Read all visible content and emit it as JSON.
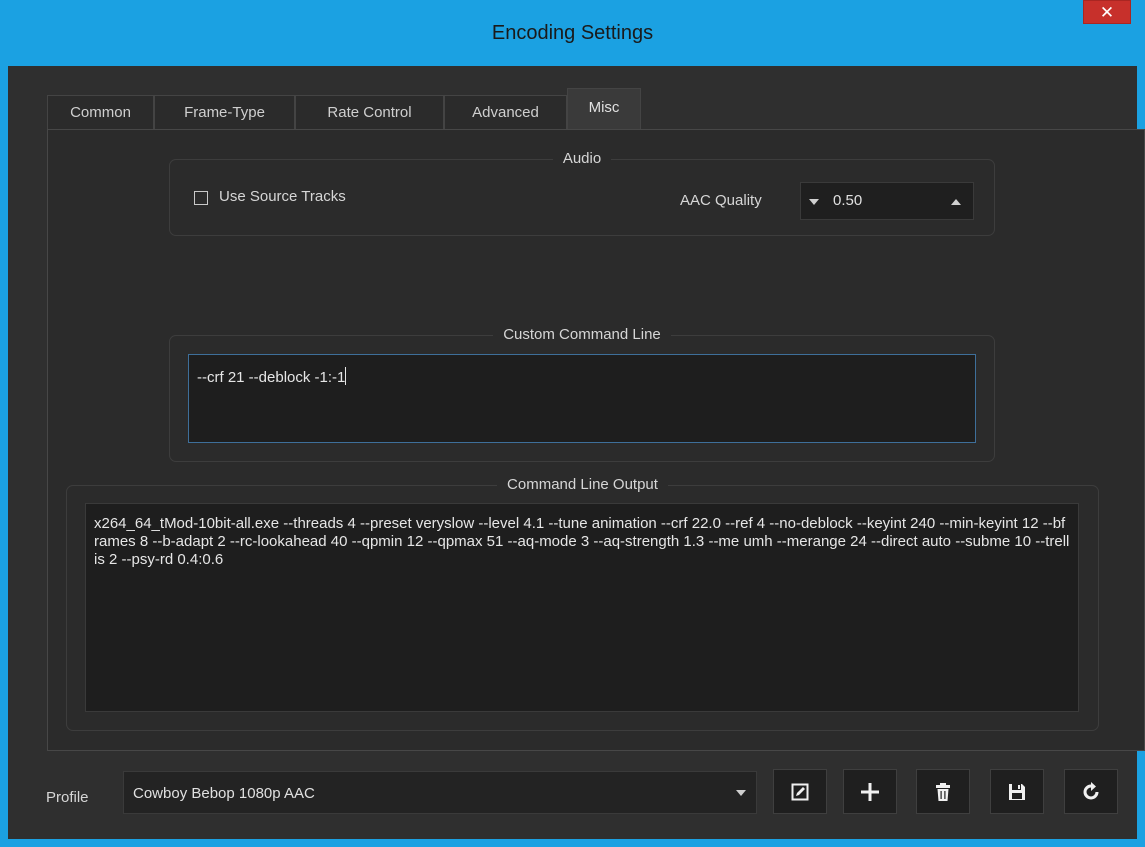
{
  "window": {
    "title": "Encoding Settings",
    "close_glyph": "✕",
    "accent_color": "#1ba1e2",
    "close_color": "#c7302b"
  },
  "tabs": [
    {
      "label": "Common",
      "active": false
    },
    {
      "label": "Frame-Type",
      "active": false
    },
    {
      "label": "Rate Control",
      "active": false
    },
    {
      "label": "Advanced",
      "active": false
    },
    {
      "label": "Misc",
      "active": true
    }
  ],
  "audio": {
    "title": "Audio",
    "use_source_tracks_label": "Use Source Tracks",
    "use_source_tracks_checked": false,
    "aac_quality_label": "AAC Quality",
    "aac_quality_value": "0.50"
  },
  "custom_command_line": {
    "title": "Custom Command Line",
    "value": "--crf 21 --deblock -1:-1"
  },
  "command_line_output": {
    "title": "Command Line Output",
    "value": "x264_64_tMod-10bit-all.exe --threads 4 --preset veryslow --level 4.1 --tune animation --crf 22.0 --ref 4 --no-deblock --keyint 240 --min-keyint 12 --bframes 8 --b-adapt 2 --rc-lookahead 40 --qpmin 12 --qpmax 51 --aq-mode 3 --aq-strength 1.3 --me umh --merange 24 --direct auto --subme 10 --trellis 2 --psy-rd 0.4:0.6"
  },
  "profile": {
    "label": "Profile",
    "selected": "Cowboy Bebop 1080p AAC"
  },
  "toolbar_icons": [
    "edit-icon",
    "add-icon",
    "delete-icon",
    "save-icon",
    "reload-icon"
  ]
}
